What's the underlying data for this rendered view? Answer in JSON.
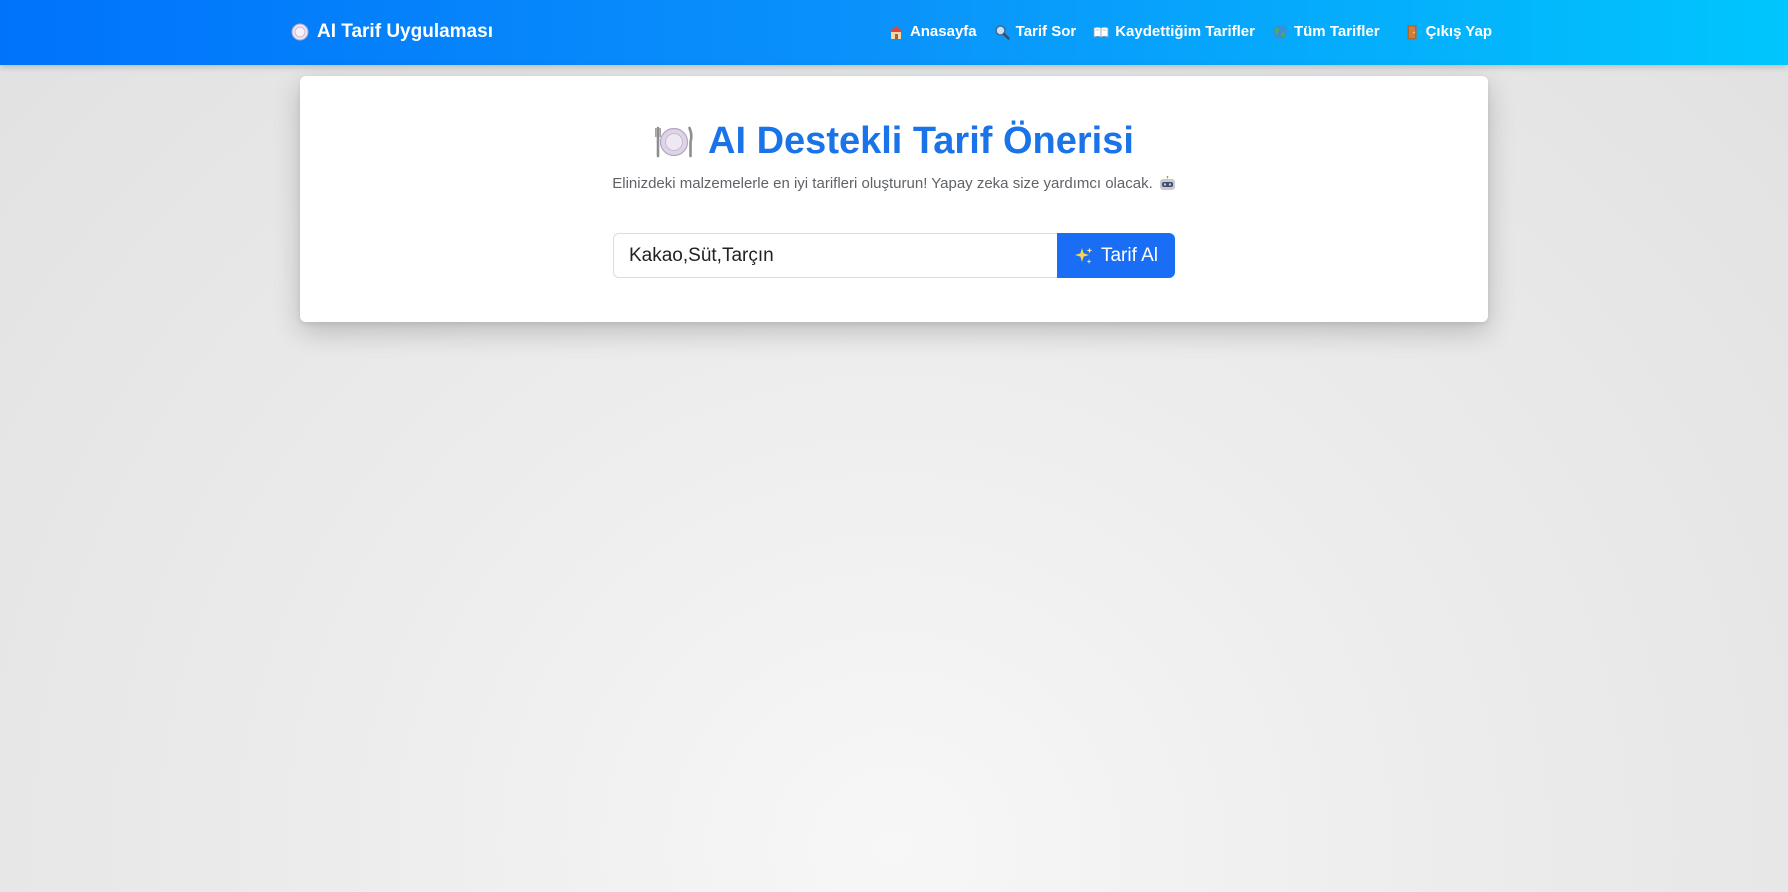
{
  "navbar": {
    "brand": {
      "icon": "plate-icon",
      "label": "AI Tarif Uygulaması"
    },
    "links": [
      {
        "icon": "house-icon",
        "label": "Anasayfa"
      },
      {
        "icon": "magnifier-icon",
        "label": "Tarif Sor"
      },
      {
        "icon": "open-book-icon",
        "label": "Kaydettiğim Tarifler"
      },
      {
        "icon": "globe-icon",
        "label": "Tüm Tarifler"
      },
      {
        "icon": "door-icon",
        "label": "Çıkış Yap"
      }
    ]
  },
  "main": {
    "title": "AI Destekli Tarif Önerisi",
    "title_icon": "plate-fork-knife-icon",
    "subtitle": "Elinizdeki malzemelerle en iyi tarifleri oluşturun! Yapay zeka size yardımcı olacak.",
    "subtitle_icon": "robot-icon",
    "form": {
      "input_value": "Kakao,Süt,Tarçın",
      "submit_label": "Tarif Al",
      "submit_icon": "sparkles-icon"
    }
  },
  "colors": {
    "navbar_start": "#0073fb",
    "navbar_end": "#00c6fd",
    "accent": "#1a73e8",
    "button": "#1a6ef5"
  }
}
